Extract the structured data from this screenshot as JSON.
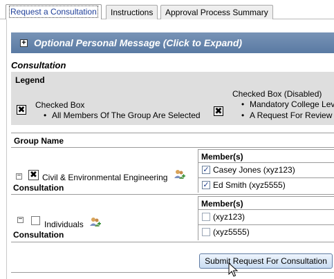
{
  "tabs": [
    {
      "label": "Request a Consultation",
      "active": true
    },
    {
      "label": "Instructions",
      "active": false
    },
    {
      "label": "Approval Process Summary",
      "active": false
    }
  ],
  "message_bar": {
    "title": "Optional Personal Message (Click to Expand)",
    "icon": "plus-box-icon"
  },
  "section_title": "Consultation",
  "legend": {
    "title": "Legend",
    "items": [
      {
        "label": "Checked Box",
        "bullets": [
          "All Members Of The Group Are Selected"
        ]
      },
      {
        "label": "Checked Box (Disabled)",
        "bullets": [
          "Mandatory College Lev",
          "A Request For Review"
        ]
      }
    ]
  },
  "table": {
    "group_header": "Group Name",
    "members_header": "Member(s)",
    "groups": [
      {
        "name": "Civil & Environmental Engineering",
        "type": "Consultation",
        "checked": true,
        "members": [
          {
            "name": "Casey Jones (xyz123)",
            "checked": true
          },
          {
            "name": "Ed Smith (xyz5555)",
            "checked": true
          }
        ]
      },
      {
        "name": "Individuals",
        "type": "Consultation",
        "checked": false,
        "members": [
          {
            "name": "(xyz123)",
            "checked": false
          },
          {
            "name": "(xyz5555)",
            "checked": false
          }
        ]
      }
    ]
  },
  "submit_label": "Submit Request For Consultation",
  "colors": {
    "bar": "#5a7aa3",
    "legend_bg": "#dedede",
    "active_tab_text": "#1f3f99"
  }
}
